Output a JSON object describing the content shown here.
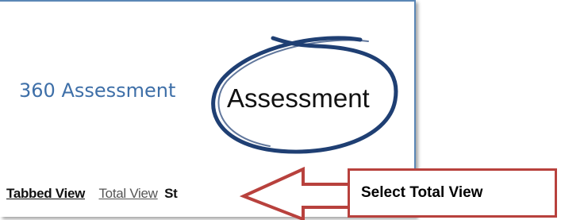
{
  "page_title": "360 Assessment",
  "annotation": {
    "circle_label": "Assessment",
    "circle_color": "#1f3f73",
    "arrow_color": "#b8413d",
    "instruction": "Select Total View"
  },
  "view_bar": {
    "tabbed_view": "Tabbed View",
    "total_view": "Total View",
    "truncated_text": "St"
  }
}
